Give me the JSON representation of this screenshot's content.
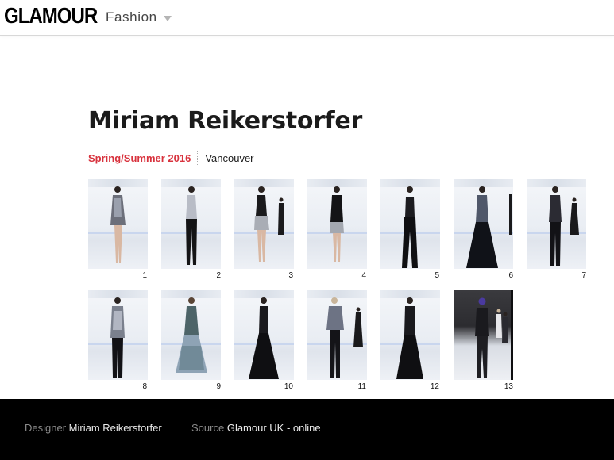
{
  "header": {
    "logo": "GLAMOUR",
    "section": "Fashion"
  },
  "show": {
    "designer_title": "Miriam Reikerstorfer",
    "season": "Spring/Summer 2016",
    "city": "Vancouver"
  },
  "gallery": {
    "looks": [
      {
        "number": "1"
      },
      {
        "number": "2"
      },
      {
        "number": "3"
      },
      {
        "number": "4"
      },
      {
        "number": "5"
      },
      {
        "number": "6"
      },
      {
        "number": "7"
      },
      {
        "number": "8"
      },
      {
        "number": "9"
      },
      {
        "number": "10"
      },
      {
        "number": "11"
      },
      {
        "number": "12"
      },
      {
        "number": "13"
      }
    ]
  },
  "footer": {
    "designer_key": "Designer",
    "designer_value": "Miriam Reikerstorfer",
    "source_key": "Source",
    "source_value": "Glamour UK - online"
  },
  "colors": {
    "accent": "#d8323d",
    "footer_bg": "#000000"
  }
}
